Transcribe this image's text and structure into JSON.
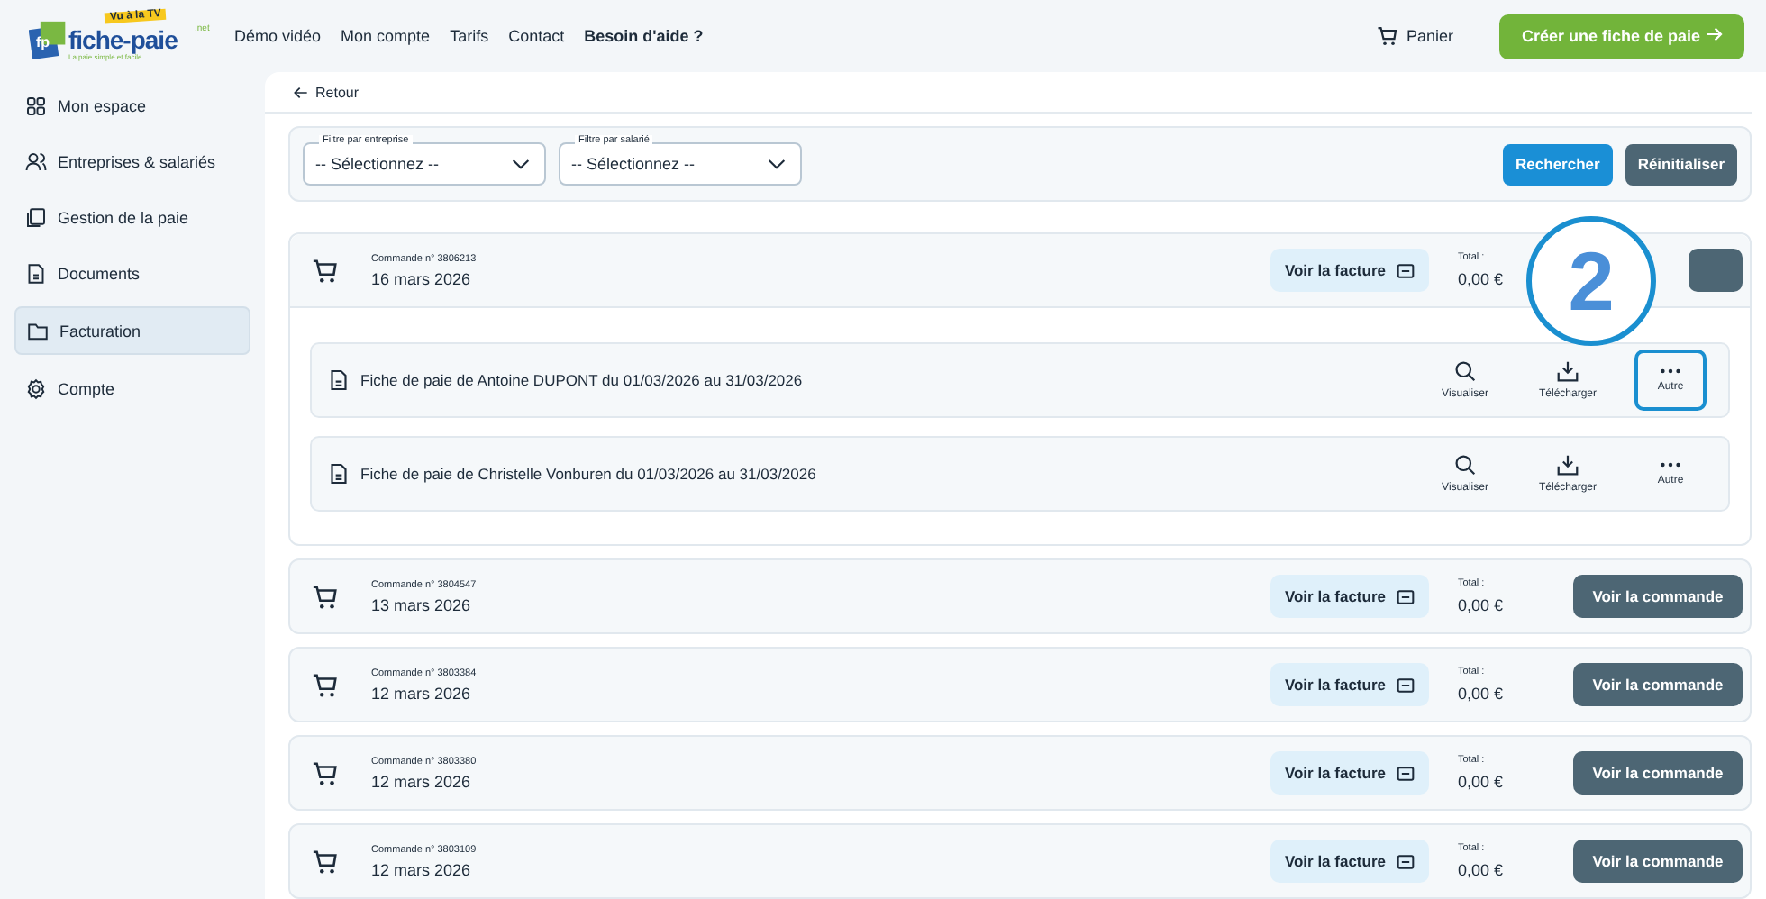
{
  "header": {
    "logo": {
      "badge": "Vu à la TV",
      "mark": "fp",
      "name": "fiche-paie",
      "suffix": ".net",
      "tagline": "La paie simple et facile"
    },
    "nav": [
      {
        "label": "Démo vidéo",
        "bold": false
      },
      {
        "label": "Mon compte",
        "bold": false
      },
      {
        "label": "Tarifs",
        "bold": false
      },
      {
        "label": "Contact",
        "bold": false
      },
      {
        "label": "Besoin d'aide ?",
        "bold": true
      }
    ],
    "cart": "Panier",
    "cta": "Créer une fiche de paie"
  },
  "sidebar": {
    "items": [
      {
        "label": "Mon espace",
        "selected": false
      },
      {
        "label": "Entreprises & salariés",
        "selected": false
      },
      {
        "label": "Gestion de la paie",
        "selected": false
      },
      {
        "label": "Documents",
        "selected": false
      },
      {
        "label": "Facturation",
        "selected": true
      },
      {
        "label": "Compte",
        "selected": false
      }
    ]
  },
  "back": "Retour",
  "filters": {
    "selects": [
      {
        "label": "Filtre par entreprise",
        "value": "-- Sélectionnez --"
      },
      {
        "label": "Filtre par salarié",
        "value": "-- Sélectionnez --"
      }
    ],
    "search": "Rechercher",
    "reset": "Réinitialiser"
  },
  "orders": [
    {
      "number": "Commande n° 3806213",
      "date": "16 mars 2026",
      "invoice": "Voir la facture",
      "total_label": "Total :",
      "total": "0,00 €",
      "expanded": true,
      "items": [
        {
          "title": "Fiche de paie de Antoine DUPONT du 01/03/2026 au 31/03/2026",
          "actions": [
            {
              "kind": "view",
              "label": "Visualiser",
              "highlighted": false
            },
            {
              "kind": "download",
              "label": "Télécharger",
              "highlighted": false
            },
            {
              "kind": "more",
              "label": "Autre",
              "highlighted": true
            }
          ]
        },
        {
          "title": "Fiche de paie de Christelle Vonburen du 01/03/2026 au 31/03/2026",
          "actions": [
            {
              "kind": "view",
              "label": "Visualiser",
              "highlighted": false
            },
            {
              "kind": "download",
              "label": "Télécharger",
              "highlighted": false
            },
            {
              "kind": "more",
              "label": "Autre",
              "highlighted": false
            }
          ]
        }
      ]
    },
    {
      "number": "Commande n° 3804547",
      "date": "13 mars 2026",
      "invoice": "Voir la facture",
      "total_label": "Total :",
      "total": "0,00 €",
      "order_button": "Voir la commande",
      "expanded": false
    },
    {
      "number": "Commande n° 3803384",
      "date": "12 mars 2026",
      "invoice": "Voir la facture",
      "total_label": "Total :",
      "total": "0,00 €",
      "order_button": "Voir la commande",
      "expanded": false
    },
    {
      "number": "Commande n° 3803380",
      "date": "12 mars 2026",
      "invoice": "Voir la facture",
      "total_label": "Total :",
      "total": "0,00 €",
      "order_button": "Voir la commande",
      "expanded": false
    },
    {
      "number": "Commande n° 3803109",
      "date": "12 mars 2026",
      "invoice": "Voir la facture",
      "total_label": "Total :",
      "total": "0,00 €",
      "order_button": "Voir la commande",
      "expanded": false
    }
  ],
  "callout": {
    "number": "2"
  }
}
